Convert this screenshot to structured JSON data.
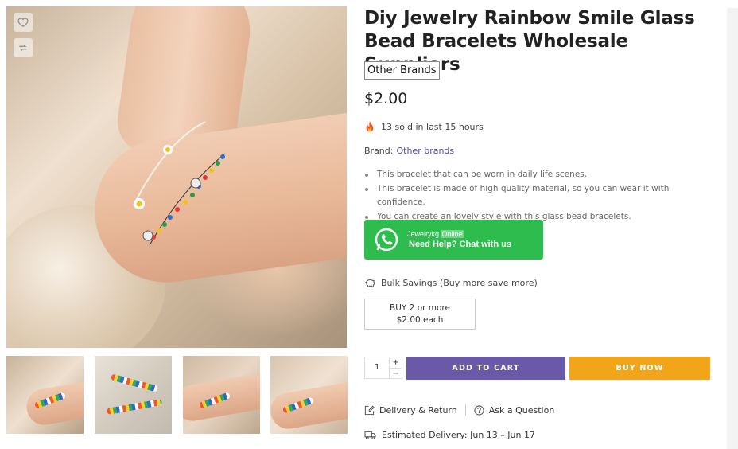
{
  "product": {
    "title": "Diy Jewelry Rainbow Smile Glass Bead Bracelets Wholesale Suppliers",
    "brand_tag": "Other Brands",
    "price": "$2.00",
    "sold_text": "13 sold in last 15 hours",
    "brand_label": "Brand:",
    "brand_link": "Other brands",
    "features": [
      "This bracelet that can be worn in daily life scenes.",
      "This bracelet is made of high quality material, so you can wear it with confidence.",
      "You can create an lovely style with this glass bead bracelets."
    ]
  },
  "whatsapp": {
    "name": "Jewelrykg",
    "status": "Online",
    "cta": "Need Help? Chat with us"
  },
  "bulk": {
    "label": "Bulk Savings (Buy more save more)",
    "tier_qty": "BUY 2 or more",
    "tier_price": "$2.00 each"
  },
  "cart": {
    "quantity": "1",
    "plus": "+",
    "minus": "−",
    "add_label": "ADD TO CART",
    "buy_label": "BUY NOW"
  },
  "links": {
    "delivery_return": "Delivery & Return",
    "ask_question": "Ask a Question",
    "estimated_delivery": "Estimated Delivery: Jun 13 – Jun 17"
  },
  "colors": {
    "accent_purple": "#6a58a9",
    "buy_orange": "#f2a519",
    "whatsapp_green": "#2ebc4f",
    "brand_link": "#4e4790"
  },
  "icons": {
    "wishlist": "heart-icon",
    "compare": "refresh-icon",
    "sold": "fire-icon",
    "bulk": "piggy-bank-icon",
    "delivery": "edit-box-icon",
    "question": "question-circle-icon",
    "estimated": "truck-icon",
    "chat": "whatsapp-icon"
  }
}
